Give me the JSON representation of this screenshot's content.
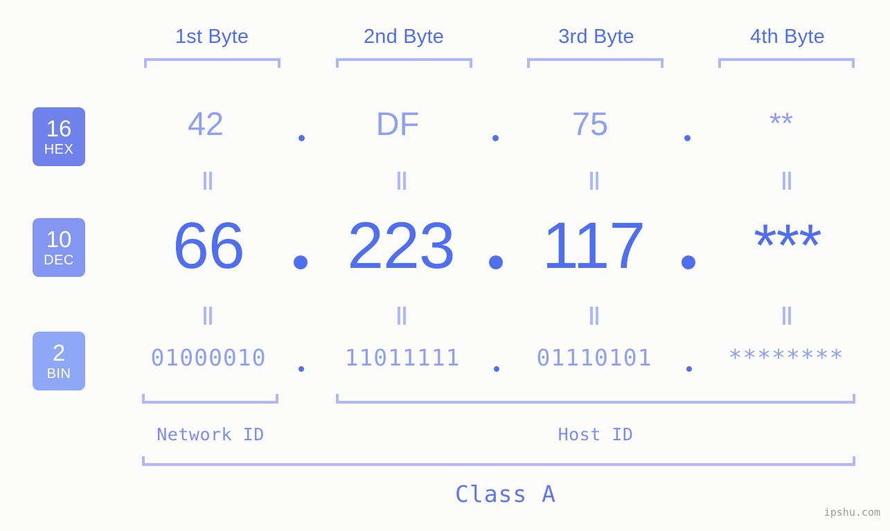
{
  "background": "#fcfdfa",
  "colors": {
    "accent_strong": "#4f6ef0",
    "accent_mid": "#8fa0f4",
    "accent_light": "#aeb8fb",
    "badge_hex": "#6f82ec",
    "badge_dec": "#8396f2",
    "badge_bin": "#8fa7f7",
    "watermark": "#9b9b9b"
  },
  "headers": [
    {
      "label": "1st Byte"
    },
    {
      "label": "2nd Byte"
    },
    {
      "label": "3rd Byte"
    },
    {
      "label": "4th Byte"
    }
  ],
  "bases": [
    {
      "number": "16",
      "name": "HEX"
    },
    {
      "number": "10",
      "name": "DEC"
    },
    {
      "number": "2",
      "name": "BIN"
    }
  ],
  "rows": {
    "hex": {
      "base": "16",
      "name": "HEX",
      "values": [
        "42",
        "DF",
        "75",
        "**"
      ]
    },
    "dec": {
      "base": "10",
      "name": "DEC",
      "values": [
        "66",
        "223",
        "117",
        "***"
      ]
    },
    "bin": {
      "base": "2",
      "name": "BIN",
      "values": [
        "01000010",
        "11011111",
        "01110101",
        "********"
      ]
    }
  },
  "separator_dot": ".",
  "equals_marker": "=",
  "segments": {
    "network_id": "Network ID",
    "host_id": "Host ID"
  },
  "class_label": "Class A",
  "watermark": "ipshu.com"
}
